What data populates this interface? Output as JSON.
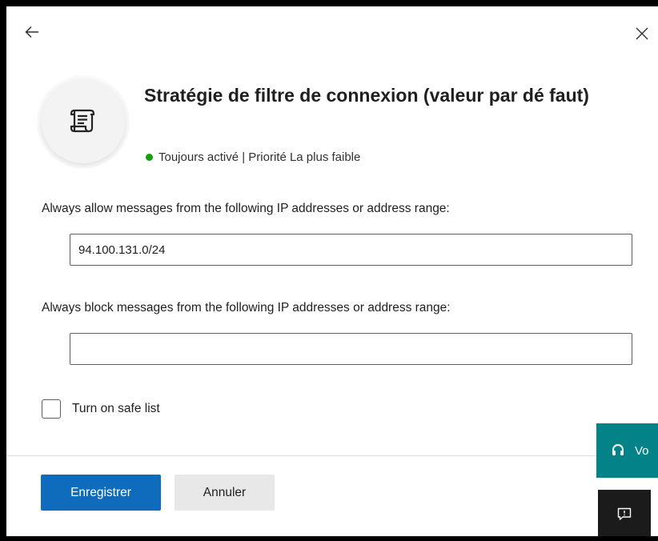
{
  "header": {
    "title": "Stratégie de filtre de connexion (valeur par dé faut)",
    "status_text": "Toujours activé | Priorité La plus faible",
    "status_color": "#13a10e",
    "back_icon": "arrow-left-icon",
    "close_icon": "close-icon",
    "policy_icon": "scroll-document-icon"
  },
  "allow": {
    "label": "Always allow messages from the following IP addresses or address range:",
    "value": "94.100.131.0/24"
  },
  "block": {
    "label": "Always block messages from the following IP addresses or address range:",
    "value": ""
  },
  "safe_list": {
    "label": "Turn on safe list",
    "checked": false
  },
  "footer": {
    "save_label": "Enregistrer",
    "cancel_label": "Annuler",
    "primary_color": "#0f6cbd"
  },
  "side_widgets": {
    "help_label": "Vo",
    "help_icon": "headset-icon",
    "help_color": "#038387",
    "feedback_icon": "feedback-icon"
  }
}
